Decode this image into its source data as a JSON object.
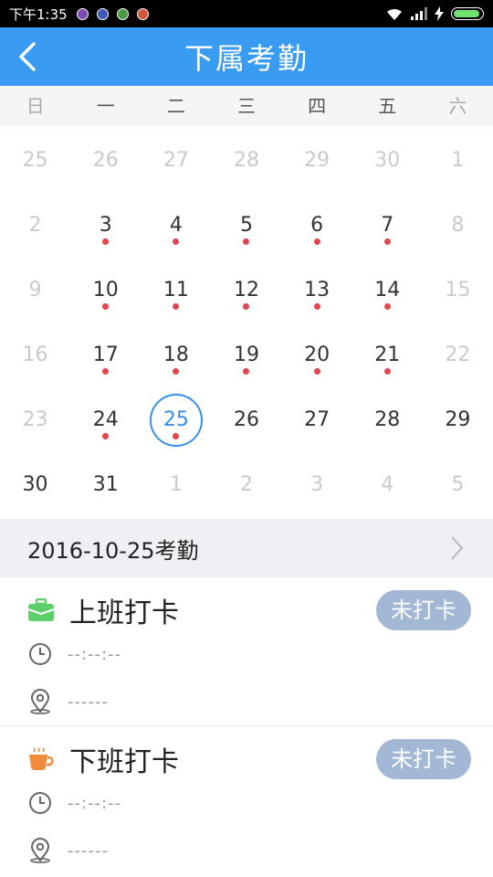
{
  "status_bar": {
    "time": "下午1:35",
    "icons": [
      "app-icon-1",
      "app-icon-2",
      "app-icon-3",
      "app-icon-4",
      "wifi-icon",
      "signal-icon",
      "charging-icon",
      "battery-icon"
    ],
    "battery_level": 0.95,
    "battery_color": "#6fe26f"
  },
  "header": {
    "title": "下属考勤",
    "back_icon": "chevron-left-icon",
    "background": "#3a9bf2"
  },
  "weekdays": [
    "日",
    "一",
    "二",
    "三",
    "四",
    "五",
    "六"
  ],
  "calendar": {
    "weeks": [
      [
        {
          "d": "25",
          "m": true
        },
        {
          "d": "26",
          "m": true
        },
        {
          "d": "27",
          "m": true
        },
        {
          "d": "28",
          "m": true
        },
        {
          "d": "29",
          "m": true
        },
        {
          "d": "30",
          "m": true
        },
        {
          "d": "1",
          "m": true
        }
      ],
      [
        {
          "d": "2",
          "m": true
        },
        {
          "d": "3",
          "dot": true
        },
        {
          "d": "4",
          "dot": true
        },
        {
          "d": "5",
          "dot": true
        },
        {
          "d": "6",
          "dot": true
        },
        {
          "d": "7",
          "dot": true
        },
        {
          "d": "8",
          "m": true
        }
      ],
      [
        {
          "d": "9",
          "m": true
        },
        {
          "d": "10",
          "dot": true
        },
        {
          "d": "11",
          "dot": true
        },
        {
          "d": "12",
          "dot": true
        },
        {
          "d": "13",
          "dot": true
        },
        {
          "d": "14",
          "dot": true
        },
        {
          "d": "15",
          "m": true
        }
      ],
      [
        {
          "d": "16",
          "m": true
        },
        {
          "d": "17",
          "dot": true
        },
        {
          "d": "18",
          "dot": true
        },
        {
          "d": "19",
          "dot": true
        },
        {
          "d": "20",
          "dot": true
        },
        {
          "d": "21",
          "dot": true
        },
        {
          "d": "22",
          "m": true
        }
      ],
      [
        {
          "d": "23",
          "m": true
        },
        {
          "d": "24",
          "dot": true
        },
        {
          "d": "25",
          "dot": true,
          "selected": true
        },
        {
          "d": "26"
        },
        {
          "d": "27"
        },
        {
          "d": "28"
        },
        {
          "d": "29"
        }
      ],
      [
        {
          "d": "30"
        },
        {
          "d": "31"
        },
        {
          "d": "1",
          "m": true
        },
        {
          "d": "2",
          "m": true
        },
        {
          "d": "3",
          "m": true
        },
        {
          "d": "4",
          "m": true
        },
        {
          "d": "5",
          "m": true
        }
      ]
    ],
    "dot_color": "#e2454e",
    "selected_color": "#3a8ee6"
  },
  "date_bar": {
    "text": "2016-10-25考勤",
    "chevron_icon": "chevron-right-icon"
  },
  "records": [
    {
      "label": "上班打卡",
      "icon": "briefcase-icon",
      "icon_color": "#5ccf6a",
      "status": "未打卡",
      "time_icon": "clock-icon",
      "time": "--:--:--",
      "location_icon": "location-pin-icon",
      "location": "------"
    },
    {
      "label": "下班打卡",
      "icon": "coffee-cup-icon",
      "icon_color": "#f28a3c",
      "status": "未打卡",
      "time_icon": "clock-icon",
      "time": "--:--:--",
      "location_icon": "location-pin-icon",
      "location": "------"
    }
  ]
}
